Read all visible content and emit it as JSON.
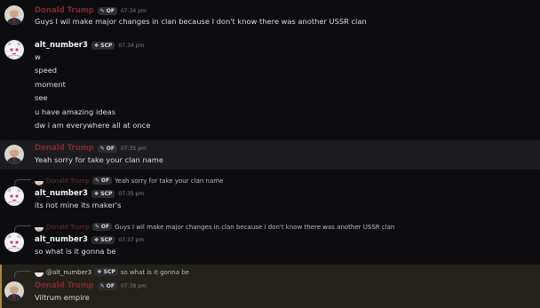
{
  "users": {
    "u1": {
      "name": "Donald Trump",
      "tag": "OF"
    },
    "u2": {
      "name": "alt_number3",
      "tag": "SCP"
    }
  },
  "messages": [
    {
      "time": "07:34 pm",
      "lines": [
        "Guys I wil make major changes in clan because I don't know there was another USSR clan"
      ]
    },
    {
      "time": "07:34 pm",
      "lines": [
        "w",
        "speed",
        "moment",
        "see",
        "u have amazing ideas",
        "dw i am everywhere all at once"
      ]
    },
    {
      "time": "07:35 pm",
      "lines": [
        "Yeah sorry for take your clan name"
      ]
    },
    {
      "time": "07:35 pm",
      "reply": {
        "text": "Yeah sorry for take your clan name"
      },
      "lines": [
        "its not mine its maker's"
      ]
    },
    {
      "time": "07:37 pm",
      "reply": {
        "text": "Guys I wil make major changes in clan because I don't know there was another USSR clan"
      },
      "lines": [
        "so what is it gonna be"
      ]
    },
    {
      "time": "07:38 pm",
      "reply": {
        "name": "@alt_number3",
        "text": "so what is it gonna be"
      },
      "lines": [
        "Viltrum empire"
      ]
    }
  ],
  "colors": {
    "background": "#0d0d10",
    "highlight": "#1c1c20",
    "mention_bg": "#24211a",
    "mention_bar": "#a8893b",
    "red_name": "#7a2a2d"
  }
}
